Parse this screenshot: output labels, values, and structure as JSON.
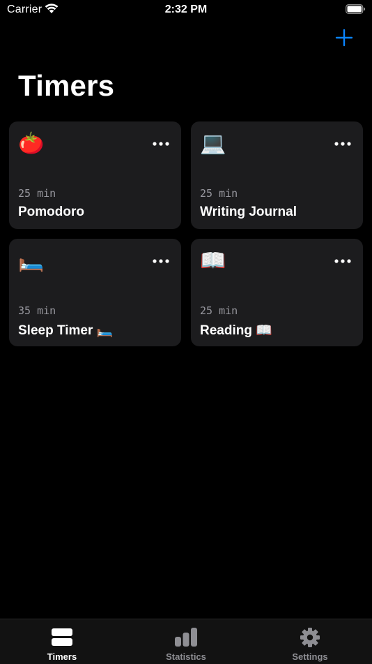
{
  "status_bar": {
    "carrier": "Carrier",
    "time": "2:32 PM"
  },
  "header": {
    "title": "Timers",
    "add_icon": "plus-icon"
  },
  "colors": {
    "accent": "#0a84ff",
    "card_background": "#1c1c1e",
    "secondary_text": "#98989f",
    "tab_active": "#ffffff",
    "tab_inactive": "#8e8e93"
  },
  "timers": [
    {
      "emoji": "🍅",
      "duration": "25 min",
      "name": "Pomodoro"
    },
    {
      "emoji": "💻",
      "duration": "25 min",
      "name": "Writing Journal"
    },
    {
      "emoji": "🛏️",
      "duration": "35 min",
      "name": "Sleep Timer 🛏️"
    },
    {
      "emoji": "📖",
      "duration": "25 min",
      "name": "Reading 📖"
    }
  ],
  "tab_bar": {
    "tabs": [
      {
        "label": "Timers",
        "icon": "timers-icon",
        "active": true
      },
      {
        "label": "Statistics",
        "icon": "bar-chart-icon",
        "active": false
      },
      {
        "label": "Settings",
        "icon": "gear-icon",
        "active": false
      }
    ]
  }
}
